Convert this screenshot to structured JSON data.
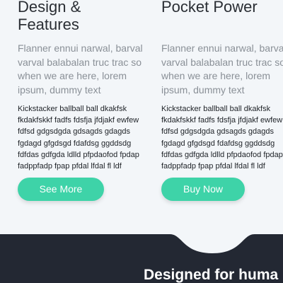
{
  "columns": [
    {
      "title_lines": [
        "Design &",
        "Features"
      ],
      "lead_lines": [
        "Flanner ennui narwal, barval",
        "varval balabalan truc trac so",
        "when we are here, lorem",
        "ipsum, dummy text"
      ],
      "body_lines": [
        "Kickstacker ballball ball dkakfsk",
        "fkdakfskkf fadfs fdsfja jfdjakf ewfew",
        "fdfsd gdgsdgda gdsagds gdagds",
        "fgdagd gfgdsgd fdafdsg ggddsdg",
        "fdfdas gdfgda ldlld pfpdaofod fpdap",
        "fadppfadp fpap pfdal lfdal fl ldf"
      ],
      "button_label": "See More"
    },
    {
      "title_lines": [
        "Pocket Power"
      ],
      "lead_lines": [
        "Flanner ennui narwal, barval",
        "varval balabalan truc trac so",
        "when we are here, lorem",
        "ipsum, dummy text"
      ],
      "body_lines": [
        "Kickstacker ballball ball dkakfsk",
        "fkdakfskkf fadfs fdsfja jfdjakf ewfew",
        "fdfsd gdgsdgda gdsagds gdagds",
        "fgdagd gfgdsgd fdafdsg ggddsdg",
        "fdfdas gdfgda ldlld pfpdaofod fpdap",
        "fadppfadp fpap pfdal lfdal fl ldf"
      ],
      "button_label": "Buy Now"
    }
  ],
  "footer": {
    "title": "Designed for huma"
  },
  "colors": {
    "page_background": "#f3f6f9",
    "accent": "#3ed3a8",
    "footer_background": "#232833",
    "heading": "#2a2e34",
    "lead": "#8a9097"
  }
}
